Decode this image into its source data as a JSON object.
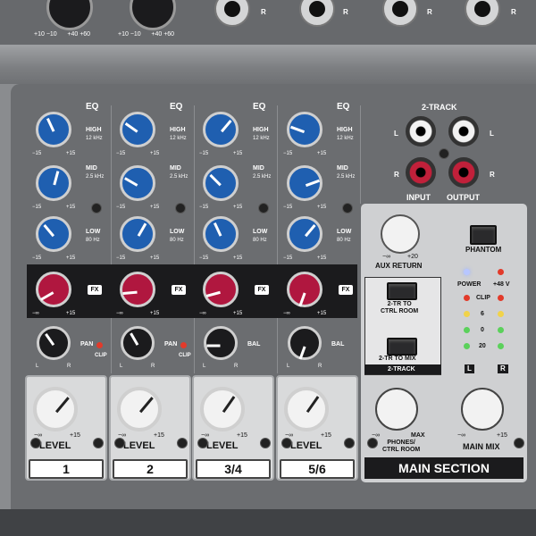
{
  "channels": [
    {
      "id": "ch1",
      "number": "1",
      "level_label": "LEVEL",
      "pan_label": "PAN",
      "has_clip": true,
      "clip_label": "CLIP"
    },
    {
      "id": "ch2",
      "number": "2",
      "level_label": "LEVEL",
      "pan_label": "PAN",
      "has_clip": true,
      "clip_label": "CLIP"
    },
    {
      "id": "ch34",
      "number": "3/4",
      "level_label": "LEVEL",
      "pan_label": "BAL",
      "has_clip": false
    },
    {
      "id": "ch56",
      "number": "5/6",
      "level_label": "LEVEL",
      "pan_label": "BAL",
      "has_clip": false
    }
  ],
  "eq": {
    "title": "EQ",
    "high": {
      "label": "HIGH",
      "freq": "12 kHz"
    },
    "mid": {
      "label": "MID",
      "freq": "2.5 kHz"
    },
    "low": {
      "label": "LOW",
      "freq": "80 Hz"
    },
    "range_min": "−15",
    "range_max": "+15",
    "center": "0"
  },
  "fx": {
    "label": "FX",
    "min": "−∞",
    "max": "+15"
  },
  "pan": {
    "left": "L",
    "right": "R"
  },
  "level": {
    "min": "−∞",
    "max": "+15"
  },
  "gain_scale": [
    "+10",
    "−10",
    "+40",
    "+60"
  ],
  "two_track": {
    "title": "2-TRACK",
    "left": "L",
    "right": "R",
    "input": "INPUT",
    "output": "OUTPUT"
  },
  "main_section": {
    "title": "MAIN SECTION",
    "aux_return": "AUX RETURN",
    "aux_min": "−∞",
    "aux_max": "+20",
    "phantom": "PHANTOM",
    "power": "POWER",
    "plus48": "+48 V",
    "clip": "CLIP",
    "meter": [
      "6",
      "0",
      "20"
    ],
    "tr_to_ctrl": "2-TR TO\nCTRL ROOM",
    "tr_to_mix": "2-TR TO MIX",
    "two_track_box": "2-TRACK",
    "phones_label": "PHONES/\nCTRL ROOM",
    "phones_min": "−∞",
    "phones_max": "MAX",
    "main_mix": "MAIN MIX",
    "main_min": "−∞",
    "main_max": "+15",
    "L": "L",
    "R": "R"
  },
  "top_jacks": {
    "right_label": "R"
  },
  "colors": {
    "eq_knob": "#1f5fb0",
    "fx_knob": "#b0173f",
    "black_knob": "#1b1b1d",
    "white_knob": "#f2f2f2",
    "panel": "#6b6d70",
    "led_red": "#e23a2a",
    "led_green": "#5bd15b",
    "led_yellow": "#f1d34a"
  },
  "knob_positions": {
    "eq": [
      [
        -25,
        15,
        -40
      ],
      [
        -55,
        -60,
        30
      ],
      [
        40,
        -45,
        -25
      ],
      [
        -70,
        70,
        40
      ]
    ],
    "fx": [
      -120,
      -95,
      -105,
      -160
    ],
    "pan": [
      -35,
      -30,
      -90,
      -160
    ],
    "level": [
      40,
      40,
      35,
      35
    ]
  }
}
